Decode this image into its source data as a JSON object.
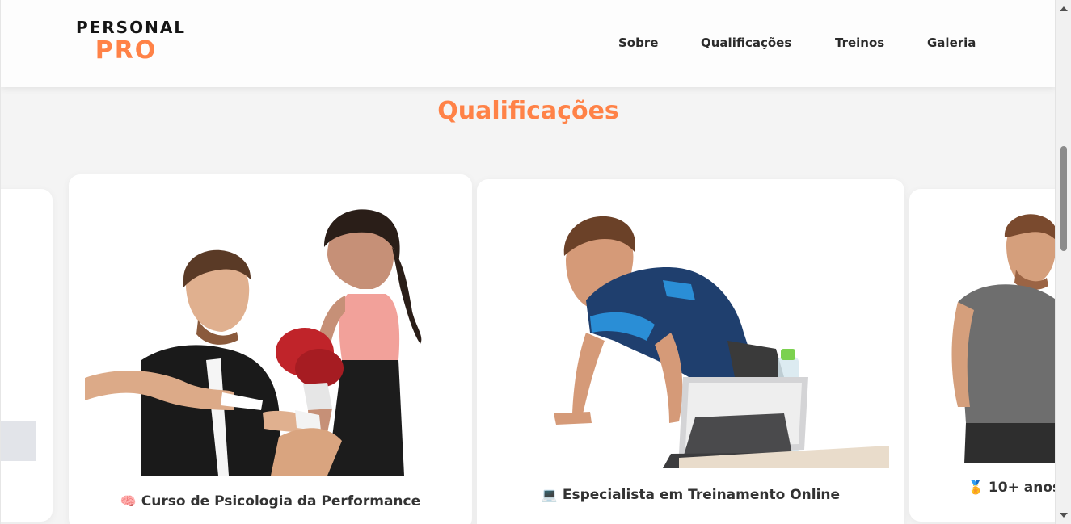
{
  "brand": {
    "top": "PERSONAL",
    "bottom": "PRO"
  },
  "nav": [
    {
      "label": "Sobre"
    },
    {
      "label": "Qualificações"
    },
    {
      "label": "Treinos"
    },
    {
      "label": "Galeria"
    }
  ],
  "section": {
    "title": "Qualificações"
  },
  "cards": [
    {
      "icon": "🧠",
      "label": "Curso de Psicologia da Performance"
    },
    {
      "icon": "💻",
      "label": "Especialista em Treinamento Online"
    },
    {
      "icon": "🏅",
      "label": "10+ anos"
    }
  ],
  "colors": {
    "accent": "#ff8247",
    "text": "#333333",
    "background": "#f4f4f4"
  }
}
